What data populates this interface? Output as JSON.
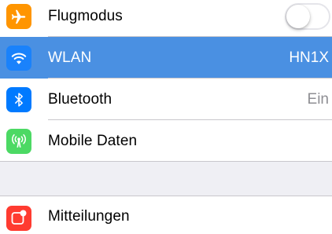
{
  "colors": {
    "background": "#efeff4",
    "selected_row": "#4a90e2",
    "airplane_icon_bg": "#ff9500",
    "wifi_icon_bg": "#1a82fb",
    "bluetooth_icon_bg": "#007aff",
    "cellular_icon_bg": "#4cd964",
    "notifications_icon_bg": "#ff3b30",
    "value_text": "#8e8e93"
  },
  "settings": {
    "airplane": {
      "label": "Flugmodus",
      "icon": "airplane-icon",
      "toggle_on": false
    },
    "wlan": {
      "label": "WLAN",
      "icon": "wifi-icon",
      "value": "HN1X",
      "selected": true
    },
    "bluetooth": {
      "label": "Bluetooth",
      "icon": "bluetooth-icon",
      "value": "Ein"
    },
    "cellular": {
      "label": "Mobile Daten",
      "icon": "antenna-icon"
    },
    "notifications": {
      "label": "Mitteilungen",
      "icon": "notifications-icon"
    }
  }
}
